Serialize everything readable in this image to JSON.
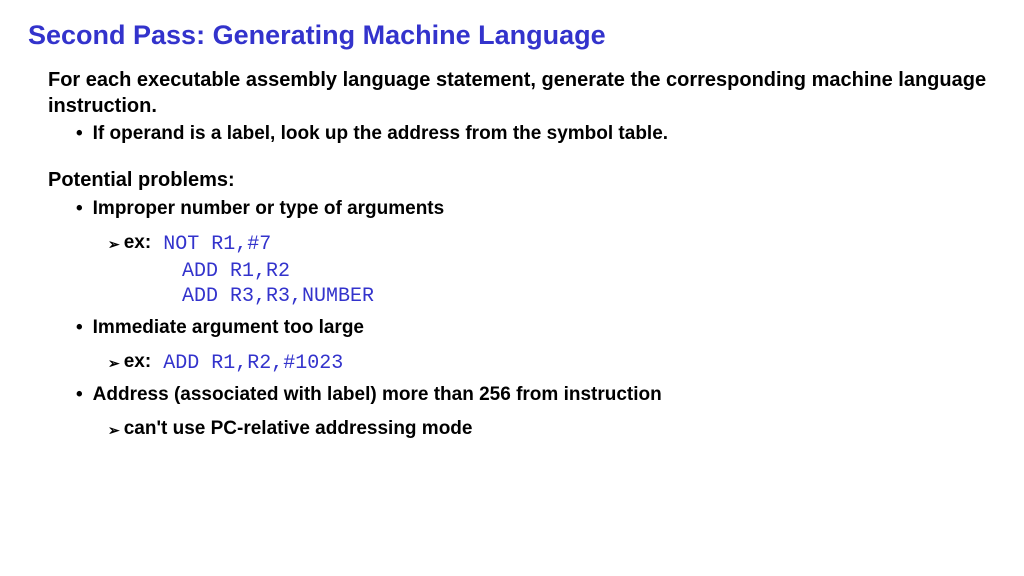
{
  "title": "Second Pass: Generating Machine Language",
  "intro": "For each executable assembly language statement, generate the corresponding machine language instruction.",
  "bullet1": "If operand is a label, look up the address from the symbol table.",
  "problems_header": "Potential problems:",
  "prob1": "Improper number or type of arguments",
  "ex_label": "ex:",
  "code1a": "NOT R1,#7",
  "code1b": "ADD R1,R2",
  "code1c": "ADD R3,R3,NUMBER",
  "prob2": "Immediate argument too large",
  "code2": "ADD R1,R2,#1023",
  "prob3": "Address (associated with label) more than 256 from instruction",
  "prob3_sub": "can't use PC-relative addressing mode"
}
